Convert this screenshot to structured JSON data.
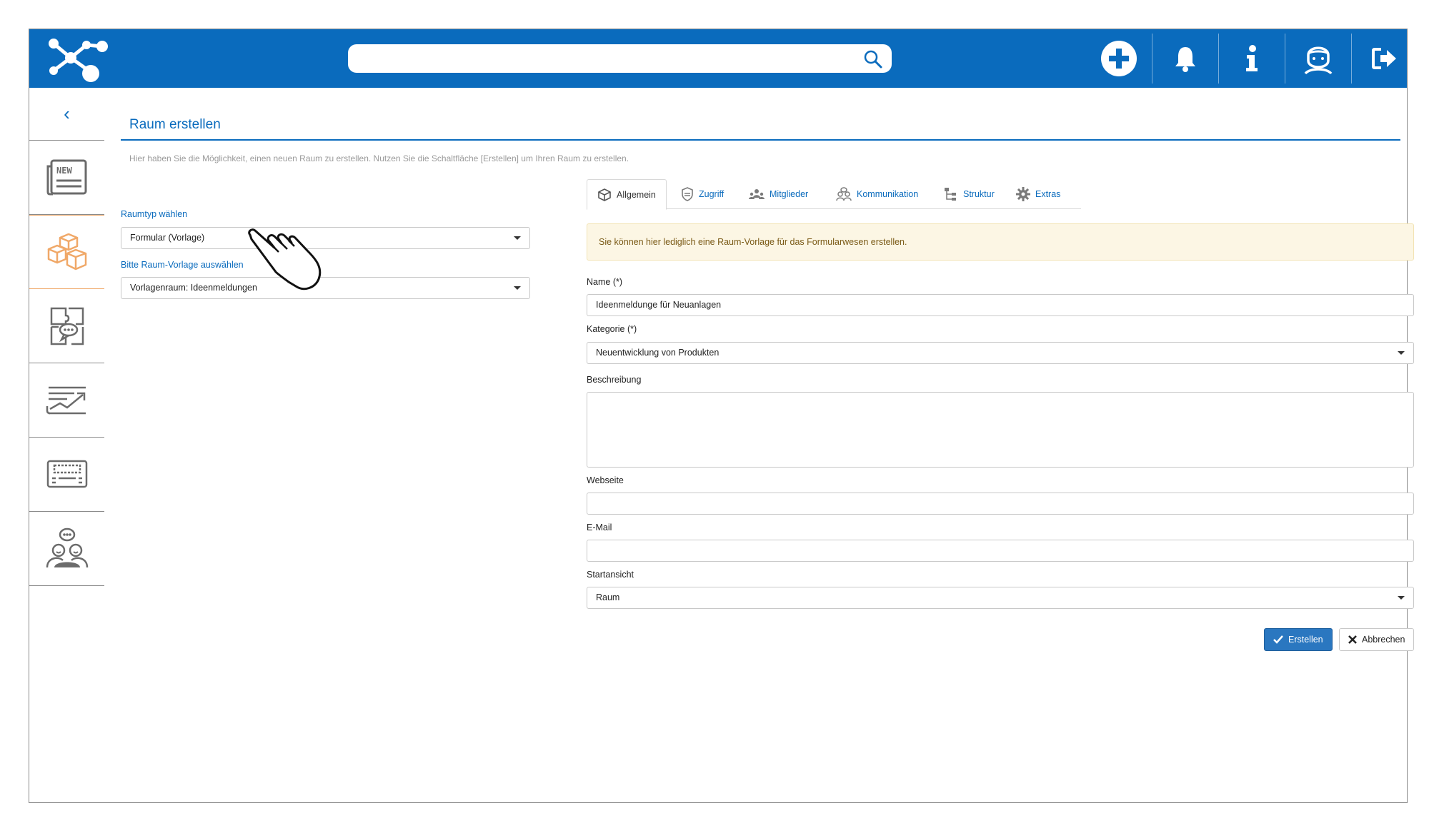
{
  "page": {
    "title": "Raum erstellen",
    "intro": "Hier haben Sie die Möglichkeit, einen neuen Raum zu erstellen. Nutzen Sie die Schaltfläche [Erstellen] um Ihren Raum zu erstellen."
  },
  "header": {
    "search": {
      "value": "",
      "placeholder": ""
    },
    "icons": [
      "plus-icon",
      "bell-icon",
      "info-icon",
      "user-avatar-icon",
      "logout-icon"
    ]
  },
  "sidebar": {
    "back_label": "‹",
    "items": [
      {
        "name": "news",
        "icon": "news-icon",
        "badge": "NEW"
      },
      {
        "name": "rooms",
        "icon": "boxes-icon",
        "active": true
      },
      {
        "name": "chat",
        "icon": "chat-puzzle-icon"
      },
      {
        "name": "reports",
        "icon": "chart-trend-icon"
      },
      {
        "name": "keyboard",
        "icon": "keyboard-icon"
      },
      {
        "name": "community",
        "icon": "people-chat-icon"
      }
    ]
  },
  "left_form": {
    "roomtype_label": "Raumtyp wählen",
    "roomtype_value": "Formular (Vorlage)",
    "template_label": "Bitte Raum-Vorlage auswählen",
    "template_value": "Vorlagenraum: Ideenmeldungen"
  },
  "tabs": [
    {
      "label": "Allgemein",
      "icon": "cube-icon",
      "active": true
    },
    {
      "label": "Zugriff",
      "icon": "shield-icon"
    },
    {
      "label": "Mitglieder",
      "icon": "members-icon"
    },
    {
      "label": "Kommunikation",
      "icon": "communication-icon"
    },
    {
      "label": "Struktur",
      "icon": "structure-icon"
    },
    {
      "label": "Extras",
      "icon": "gear-icon"
    }
  ],
  "notice": "Sie können hier lediglich eine Raum-Vorlage für das Formularwesen erstellen.",
  "form": {
    "name_label": "Name (*)",
    "name_value": "Ideenmeldunge für Neuanlagen",
    "category_label": "Kategorie (*)",
    "category_value": "Neuentwicklung von Produkten",
    "description_label": "Beschreibung",
    "description_value": "",
    "website_label": "Webseite",
    "website_value": "",
    "email_label": "E-Mail",
    "email_value": "",
    "startview_label": "Startansicht",
    "startview_value": "Raum"
  },
  "buttons": {
    "create": "Erstellen",
    "cancel": "Abbrechen"
  },
  "colors": {
    "brand_blue": "#0a6bbd",
    "active_orange": "#f0a868",
    "notice_bg": "#fcf6e4"
  }
}
